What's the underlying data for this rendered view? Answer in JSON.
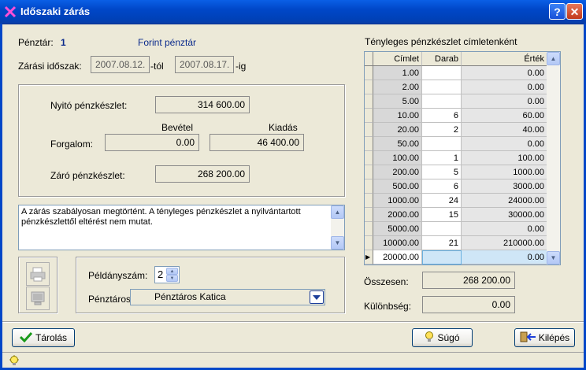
{
  "window": {
    "title": "Időszaki zárás",
    "help_label": "?",
    "close_label": "✕"
  },
  "header": {
    "penztar_label": "Pénztár:",
    "penztar_value": "1",
    "penztar_name": "Forint pénztár",
    "idoszak_label": "Zárási időszak:",
    "date_from": "2007.08.12.",
    "from_suffix": "-tól",
    "date_to": "2007.08.17.",
    "to_suffix": "-ig"
  },
  "summary": {
    "nyito_label": "Nyitó pénzkészlet:",
    "nyito_value": "314 600.00",
    "bevetel_label": "Bevétel",
    "kiadas_label": "Kiadás",
    "forgalom_label": "Forgalom:",
    "bevetel_value": "0.00",
    "kiadas_value": "46 400.00",
    "zaro_label": "Záró pénzkészlet:",
    "zaro_value": "268 200.00"
  },
  "memo": {
    "text": "A zárás szabályosan megtörtént. A tényleges pénzkészlet a nyilvántartott pénzkészlettől eltérést nem mutat."
  },
  "print": {
    "peldany_label": "Példányszám:",
    "peldany_value": "2",
    "penztaros_label": "Pénztáros:",
    "penztaros_value": "Pénztáros Katica"
  },
  "cimlet": {
    "title": "Tényleges pénzkészlet címletenként",
    "columns": [
      "Címlet",
      "Darab",
      "Érték"
    ],
    "rows": [
      [
        "1.00",
        "",
        "0.00"
      ],
      [
        "2.00",
        "",
        "0.00"
      ],
      [
        "5.00",
        "",
        "0.00"
      ],
      [
        "10.00",
        "6",
        "60.00"
      ],
      [
        "20.00",
        "2",
        "40.00"
      ],
      [
        "50.00",
        "",
        "0.00"
      ],
      [
        "100.00",
        "1",
        "100.00"
      ],
      [
        "200.00",
        "5",
        "1000.00"
      ],
      [
        "500.00",
        "6",
        "3000.00"
      ],
      [
        "1000.00",
        "24",
        "24000.00"
      ],
      [
        "2000.00",
        "15",
        "30000.00"
      ],
      [
        "5000.00",
        "",
        "0.00"
      ],
      [
        "10000.00",
        "21",
        "210000.00"
      ],
      [
        "20000.00",
        "",
        "0.00"
      ]
    ],
    "osszesen_label": "Összesen:",
    "osszesen_value": "268 200.00",
    "kulonbseg_label": "Különbség:",
    "kulonbseg_value": "0.00"
  },
  "buttons": {
    "save": "Tárolás",
    "help": "Súgó",
    "exit": "Kilépés"
  }
}
